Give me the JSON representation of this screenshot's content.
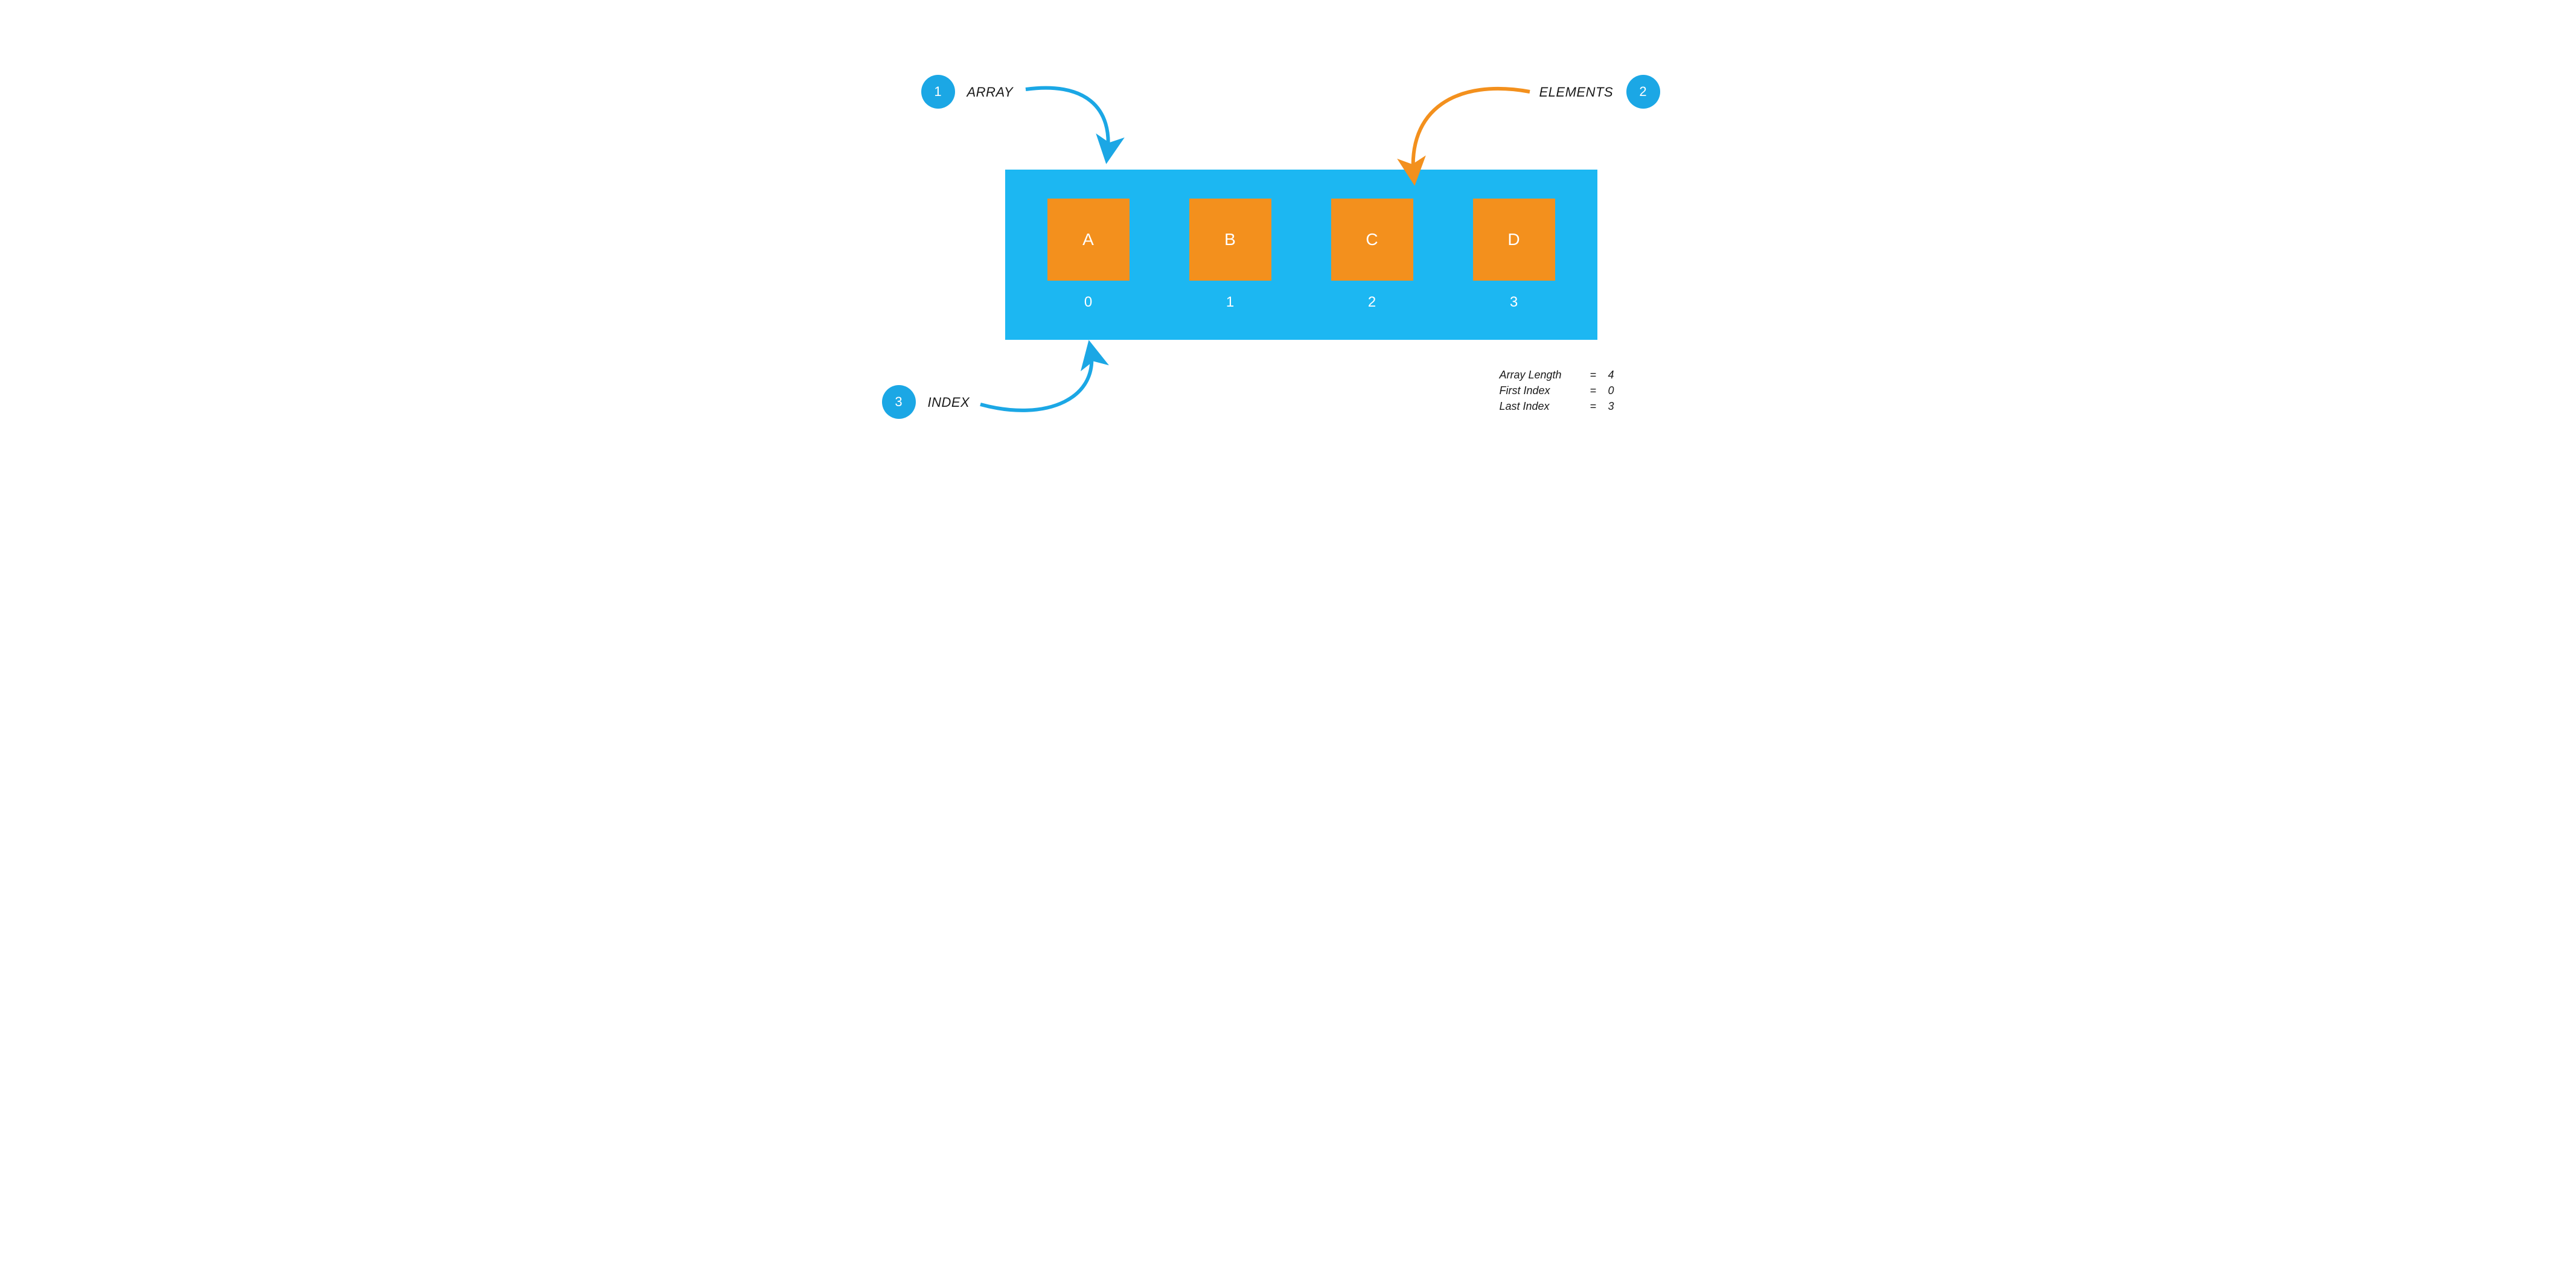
{
  "badges": {
    "one": "1",
    "two": "2",
    "three": "3"
  },
  "labels": {
    "array": "ARRAY",
    "elements": "ELEMENTS",
    "index": "INDEX"
  },
  "array": {
    "cells": [
      {
        "value": "A",
        "index": "0"
      },
      {
        "value": "B",
        "index": "1"
      },
      {
        "value": "C",
        "index": "2"
      },
      {
        "value": "D",
        "index": "3"
      }
    ]
  },
  "info": {
    "rows": [
      {
        "key": "Array Length",
        "eq": "=",
        "val": "4"
      },
      {
        "key": "First Index",
        "eq": "=",
        "val": "0"
      },
      {
        "key": "Last Index",
        "eq": "=",
        "val": "3"
      }
    ]
  },
  "colors": {
    "blue": "#1BA7E5",
    "orange": "#F3901D"
  }
}
